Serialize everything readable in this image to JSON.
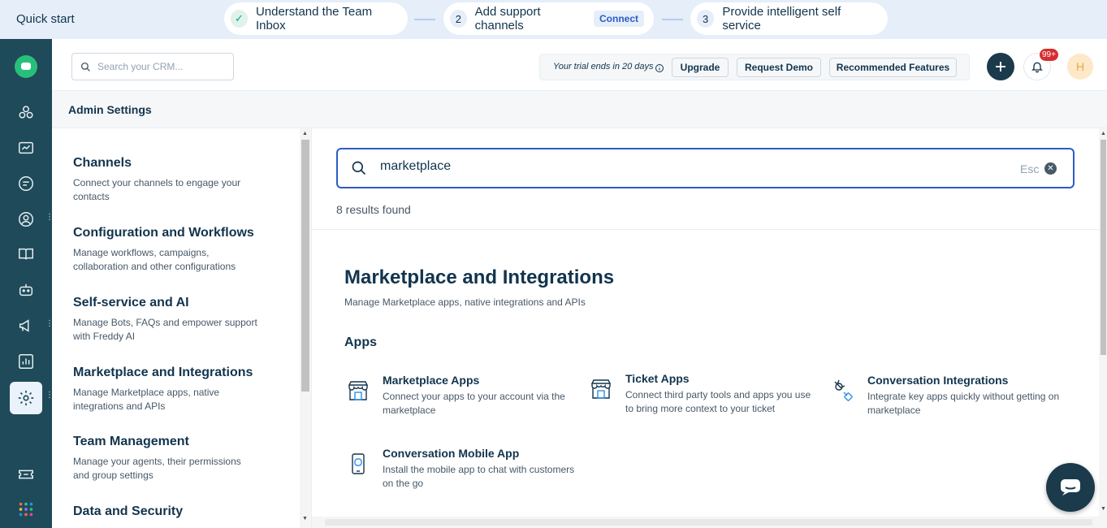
{
  "quickstart": {
    "title": "Quick start",
    "steps": [
      {
        "num": "✓",
        "label": "Understand the Team Inbox"
      },
      {
        "num": "2",
        "label": "Add support channels",
        "action": "Connect"
      },
      {
        "num": "3",
        "label": "Provide intelligent self service"
      }
    ]
  },
  "header": {
    "search_placeholder": "Search your CRM...",
    "trial_text": "Your trial ends in 20 days",
    "upgrade_label": "Upgrade",
    "request_demo_label": "Request Demo",
    "recommended_label": "Recommended Features",
    "notification_count": "99+",
    "avatar_initial": "H"
  },
  "admin": {
    "title": "Admin Settings"
  },
  "categories": [
    {
      "title": "Channels",
      "desc": "Connect your channels to engage your contacts"
    },
    {
      "title": "Configuration and Workflows",
      "desc": "Manage workflows, campaigns, collaboration and other configurations"
    },
    {
      "title": "Self-service and AI",
      "desc": "Manage Bots, FAQs and empower support with Freddy AI"
    },
    {
      "title": "Marketplace and Integrations",
      "desc": "Manage Marketplace apps, native integrations and APIs"
    },
    {
      "title": "Team Management",
      "desc": "Manage your agents, their permissions and group settings"
    },
    {
      "title": "Data and Security",
      "desc": ""
    }
  ],
  "search": {
    "value": "marketplace",
    "esc_label": "Esc",
    "results_text": "8 results found"
  },
  "section": {
    "title": "Marketplace and Integrations",
    "subtitle": "Manage Marketplace apps, native integrations and APIs",
    "group_title": "Apps",
    "apps": [
      {
        "title": "Marketplace Apps",
        "desc": "Connect your apps to your account via the marketplace",
        "icon": "store-icon"
      },
      {
        "title": "Ticket Apps",
        "desc": "Connect third party tools and apps you use to bring more context to your ticket",
        "icon": "store-icon"
      },
      {
        "title": "Conversation Integrations",
        "desc": "Integrate key apps quickly without getting on marketplace",
        "icon": "plug-icon"
      },
      {
        "title": "Conversation Mobile App",
        "desc": "Install the mobile app to chat with customers on the go",
        "icon": "mobile-icon"
      }
    ]
  },
  "colors": {
    "nav_bg": "#1f4a5a",
    "accent": "#2c5cc5",
    "text": "#12344d",
    "badge": "#d72d30"
  }
}
